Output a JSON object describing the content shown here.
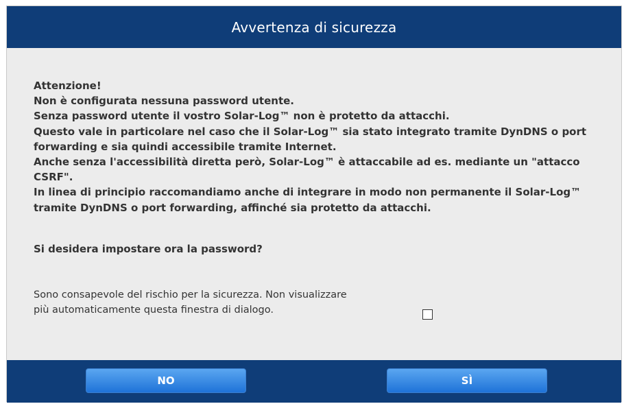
{
  "dialog": {
    "title": "Avvertenza di sicurezza",
    "warning_lines": [
      "Attenzione!",
      "Non è configurata nessuna password utente.",
      "Senza password utente il vostro Solar-Log™ non è protetto da attacchi.",
      "Questo vale in particolare nel caso che il Solar-Log™ sia stato integrato tramite DynDNS o port forwarding e sia quindi accessibile tramite Internet.",
      "Anche senza l'accessibilità diretta però, Solar-Log™ è attaccabile ad es. mediante un \"attacco CSRF\".",
      "In linea di principio raccomandiamo anche di integrare in modo non permanente il Solar-Log™ tramite DynDNS o port forwarding, affinché sia protetto da attacchi."
    ],
    "question": "Si desidera impostare ora la password?",
    "acknowledge_text": "Sono consapevole del rischio per la sicurezza. Non visualizzare più automaticamente questa finestra di dialogo.",
    "acknowledge_checked": false,
    "buttons": {
      "no_label": "NO",
      "yes_label": "SÌ"
    },
    "colors": {
      "header_background": "#0f3d78",
      "body_background": "#ececec",
      "button_gradient_top": "#5aa6f0",
      "button_gradient_bottom": "#1f73d8"
    }
  }
}
